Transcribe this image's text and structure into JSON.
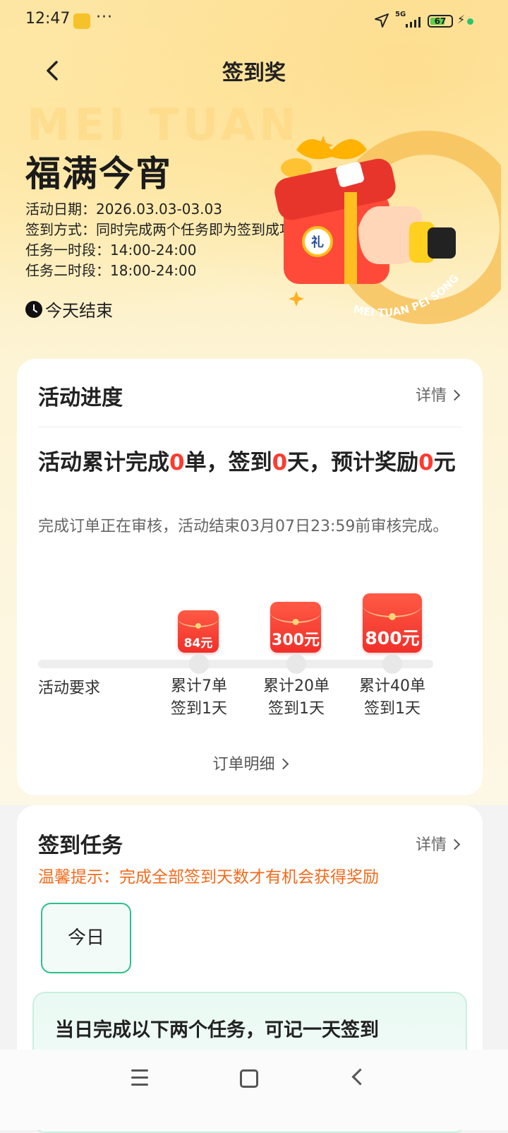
{
  "status_bar": {
    "time": "12:47",
    "dots": "···",
    "network": "5G",
    "battery": "67"
  },
  "header": {
    "title": "签到奖"
  },
  "hero": {
    "watermark": "MEI TUAN",
    "title": "福满今宵",
    "info": [
      "活动日期：2026.03.03-03.03",
      "签到方式：同时完成两个任务即为签到成功",
      "任务一时段：14:00-24:00",
      "任务二时段：18:00-24:00"
    ],
    "ends": "今天结束",
    "gift_tag": "礼",
    "gift_ring_text": "MEI TUAN PEI SONG"
  },
  "progress_card": {
    "title": "活动进度",
    "details_label": "详情",
    "summary": {
      "p1": "活动累计完成",
      "orders": "0",
      "p2": "单，签到",
      "days": "0",
      "p3": "天，预计奖励",
      "reward": "0",
      "p4": "元"
    },
    "note": "完成订单正在审核，活动结束03月07日23:59前审核完成。",
    "requirement_label": "活动要求",
    "milestones": [
      {
        "reward": "84元",
        "line1": "累计7单",
        "line2": "签到1天"
      },
      {
        "reward": "300元",
        "line1": "累计20单",
        "line2": "签到1天"
      },
      {
        "reward": "800元",
        "line1": "累计40单",
        "line2": "签到1天"
      }
    ],
    "order_details_label": "订单明细"
  },
  "task_card": {
    "title": "签到任务",
    "details_label": "详情",
    "tip": "温馨提示：完成全部签到天数才有机会获得奖励",
    "day_tab": "今日",
    "task_heading": "当日完成以下两个任务，可记一天签到"
  },
  "colors": {
    "accent_red": "#ff3a2f",
    "tip_orange": "#f26a1b",
    "green": "#2dbf8a"
  }
}
